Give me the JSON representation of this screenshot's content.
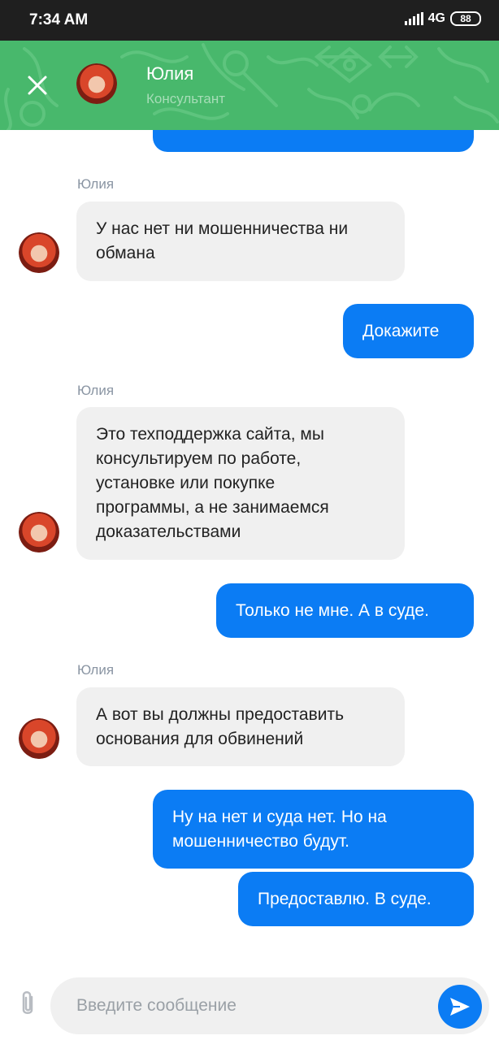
{
  "status_bar": {
    "time": "7:34 AM",
    "network": "4G",
    "battery": "88"
  },
  "header": {
    "name": "Юлия",
    "role": "Консультант"
  },
  "messages": [
    {
      "type": "in",
      "sender": "Юлия",
      "lines": [
        "У нас нет ни мошенничества ни",
        "обмана"
      ]
    },
    {
      "type": "out",
      "lines": [
        "Докажите"
      ]
    },
    {
      "type": "in",
      "sender": "Юлия",
      "lines": [
        "Это техподдержка сайта, мы",
        "консультируем по работе,",
        "установке или покупке",
        "программы, а не занимаемся",
        "доказательствами"
      ]
    },
    {
      "type": "out",
      "lines": [
        "Только не мне. А в суде."
      ]
    },
    {
      "type": "in",
      "sender": "Юлия",
      "lines": [
        "А вот вы должны предоставить",
        "основания для обвинений"
      ]
    },
    {
      "type": "out",
      "lines": [
        "Ну на нет и суда нет. Но на",
        "мошенничество будут."
      ]
    },
    {
      "type": "out",
      "lines": [
        "Предоставлю. В суде."
      ]
    }
  ],
  "input": {
    "placeholder": "Введите сообщение"
  },
  "icons": {
    "close": "close-icon",
    "attach": "paperclip-icon",
    "send": "send-icon"
  },
  "colors": {
    "header": "#48b86c",
    "outgoing": "#0b7cf4",
    "incoming": "#f0f0f0"
  }
}
